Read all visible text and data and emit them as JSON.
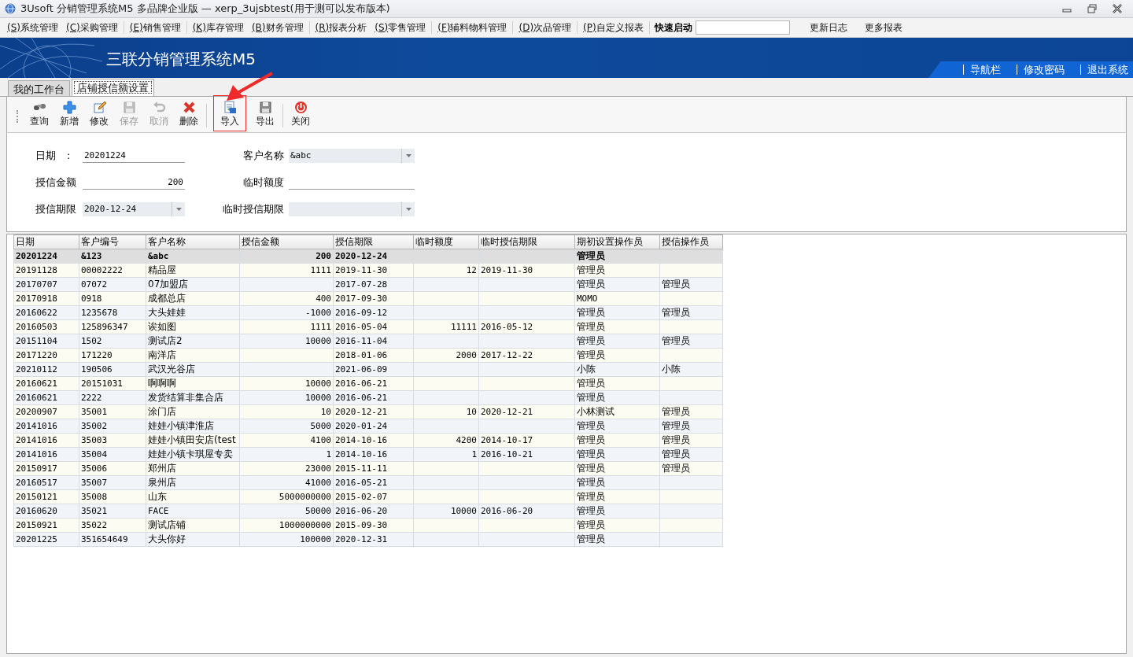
{
  "window": {
    "title": "3Usoft 分销管理系统M5 多品牌企业版 — xerp_3ujsbtest(用于测可以发布版本)"
  },
  "menu": {
    "items": [
      {
        "mnemonic": "(S)",
        "label": "系统管理"
      },
      {
        "mnemonic": "(C)",
        "label": "采购管理"
      },
      {
        "mnemonic": "(E)",
        "label": "销售管理"
      },
      {
        "mnemonic": "(K)",
        "label": "库存管理"
      },
      {
        "mnemonic": "(B)",
        "label": "财务管理"
      },
      {
        "mnemonic": "(R)",
        "label": "报表分析"
      },
      {
        "mnemonic": "(S)",
        "label": "零售管理"
      },
      {
        "mnemonic": "(F)",
        "label": "辅料物料管理"
      },
      {
        "mnemonic": "(D)",
        "label": "次品管理"
      },
      {
        "mnemonic": "(P)",
        "label": "自定义报表"
      }
    ],
    "quick_launch": {
      "label": "快速启动"
    },
    "links": [
      "更新日志",
      "更多报表"
    ]
  },
  "banner": {
    "title": "三联分销管理系统M5",
    "links": [
      "导航栏",
      "修改密码",
      "退出系统"
    ]
  },
  "tabs": [
    {
      "label": "我的工作台",
      "selected": false
    },
    {
      "label": "店铺授信额设置",
      "selected": true
    }
  ],
  "toolbar": [
    {
      "label": "查询",
      "disabled": false,
      "highlighted": false
    },
    {
      "label": "新增",
      "disabled": false,
      "highlighted": false
    },
    {
      "label": "修改",
      "disabled": false,
      "highlighted": false
    },
    {
      "label": "保存",
      "disabled": true,
      "highlighted": false
    },
    {
      "label": "取消",
      "disabled": true,
      "highlighted": false
    },
    {
      "label": "删除",
      "disabled": false,
      "highlighted": false
    },
    {
      "label": "导入",
      "disabled": false,
      "highlighted": true
    },
    {
      "label": "导出",
      "disabled": false,
      "highlighted": false
    },
    {
      "label": "关闭",
      "disabled": false,
      "highlighted": false
    }
  ],
  "form": {
    "fields": [
      {
        "kind": "text",
        "label": "日期",
        "separator": ":",
        "value": "20201224"
      },
      {
        "kind": "combo",
        "label": "客户名称",
        "value": "&abc"
      },
      {
        "kind": "number",
        "label": "授信金额",
        "value": "200"
      },
      {
        "kind": "text",
        "label": "临时额度"
      },
      {
        "kind": "combo",
        "label": "授信期限",
        "value": "2020-12-24"
      },
      {
        "kind": "combo",
        "label": "临时授信期限"
      }
    ]
  },
  "table": {
    "columns": [
      {
        "label": "日期"
      },
      {
        "label": "客户编号"
      },
      {
        "label": "客户名称"
      },
      {
        "label": "授信金额"
      },
      {
        "label": "授信期限"
      },
      {
        "label": "临时额度"
      },
      {
        "label": "临时授信期限"
      },
      {
        "label": "期初设置操作员"
      },
      {
        "label": "授信操作员"
      }
    ],
    "rows": [
      {
        "selected": true,
        "cells": [
          "20201224",
          "&123",
          "&abc",
          "200",
          "2020-12-24",
          "",
          "",
          "管理员",
          ""
        ]
      },
      {
        "selected": false,
        "cells": [
          "20191128",
          "00002222",
          "精品屋",
          "1111",
          "2019-11-30",
          "12",
          "2019-11-30",
          "管理员",
          ""
        ]
      },
      {
        "selected": false,
        "cells": [
          "20170707",
          "07072",
          "07加盟店",
          "",
          "2017-07-28",
          "",
          "",
          "管理员",
          "管理员"
        ]
      },
      {
        "selected": false,
        "cells": [
          "20170918",
          "0918",
          "成都总店",
          "400",
          "2017-09-30",
          "",
          "",
          "MOMO",
          ""
        ]
      },
      {
        "selected": false,
        "cells": [
          "20160622",
          "1235678",
          "大头娃娃",
          "-1000",
          "2016-09-12",
          "",
          "",
          "管理员",
          "管理员"
        ]
      },
      {
        "selected": false,
        "cells": [
          "20160503",
          "125896347",
          "诶如图",
          "1111",
          "2016-05-04",
          "11111",
          "2016-05-12",
          "管理员",
          ""
        ]
      },
      {
        "selected": false,
        "cells": [
          "20151104",
          "1502",
          "测试店2",
          "10000",
          "2016-11-04",
          "",
          "",
          "管理员",
          "管理员"
        ]
      },
      {
        "selected": false,
        "cells": [
          "20171220",
          "171220",
          "南洋店",
          "",
          "2018-01-06",
          "2000",
          "2017-12-22",
          "管理员",
          ""
        ]
      },
      {
        "selected": false,
        "cells": [
          "20210112",
          "190506",
          "武汉光谷店",
          "",
          "2021-06-09",
          "",
          "",
          "小陈",
          "小陈"
        ]
      },
      {
        "selected": false,
        "cells": [
          "20160621",
          "20151031",
          "啊啊啊",
          "10000",
          "2016-06-21",
          "",
          "",
          "管理员",
          ""
        ]
      },
      {
        "selected": false,
        "cells": [
          "20160621",
          "2222",
          "发货结算非集合店",
          "10000",
          "2016-06-21",
          "",
          "",
          "管理员",
          ""
        ]
      },
      {
        "selected": false,
        "cells": [
          "20200907",
          "35001",
          "涂门店",
          "10",
          "2020-12-21",
          "10",
          "2020-12-21",
          "小林测试",
          "管理员"
        ]
      },
      {
        "selected": false,
        "cells": [
          "20141016",
          "35002",
          "娃娃小镇津淮店",
          "5000",
          "2020-01-24",
          "",
          "",
          "管理员",
          "管理员"
        ]
      },
      {
        "selected": false,
        "cells": [
          "20141016",
          "35003",
          "娃娃小镇田安店(test",
          "4100",
          "2014-10-16",
          "4200",
          "2014-10-17",
          "管理员",
          "管理员"
        ]
      },
      {
        "selected": false,
        "cells": [
          "20141016",
          "35004",
          "娃娃小镇卡琪屋专卖",
          "1",
          "2014-10-16",
          "1",
          "2016-10-21",
          "管理员",
          "管理员"
        ]
      },
      {
        "selected": false,
        "cells": [
          "20150917",
          "35006",
          "郑州店",
          "23000",
          "2015-11-11",
          "",
          "",
          "管理员",
          "管理员"
        ]
      },
      {
        "selected": false,
        "cells": [
          "20160517",
          "35007",
          "泉州店",
          "41000",
          "2016-05-21",
          "",
          "",
          "管理员",
          ""
        ]
      },
      {
        "selected": false,
        "cells": [
          "20150121",
          "35008",
          "山东",
          "5000000000",
          "2015-02-07",
          "",
          "",
          "管理员",
          ""
        ]
      },
      {
        "selected": false,
        "cells": [
          "20160620",
          "35021",
          "FACE",
          "50000",
          "2016-06-20",
          "10000",
          "2016-06-20",
          "管理员",
          ""
        ]
      },
      {
        "selected": false,
        "cells": [
          "20150921",
          "35022",
          "测试店铺",
          "1000000000",
          "2015-09-30",
          "",
          "",
          "管理员",
          ""
        ]
      },
      {
        "selected": false,
        "cells": [
          "20201225",
          "351654649",
          "大头你好",
          "100000",
          "2020-12-31",
          "",
          "",
          "管理员",
          ""
        ]
      }
    ]
  }
}
